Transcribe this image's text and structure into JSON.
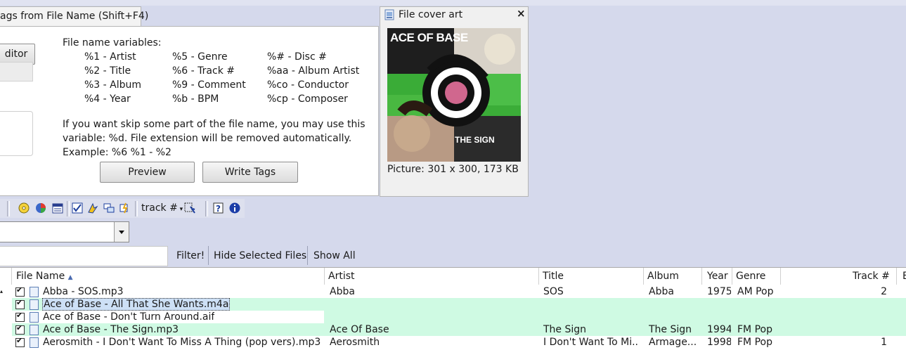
{
  "tag_panel": {
    "tab_title": "ags from File Name (Shift+F4)",
    "editor_button": "ditor",
    "heading": "File name variables:",
    "vars_col1": [
      "%1 - Artist",
      "%2 - Title",
      "%3 - Album",
      "%4 - Year"
    ],
    "vars_col2": [
      "%5 - Genre",
      "%6 - Track #",
      "%9 - Comment",
      "%b - BPM"
    ],
    "vars_col3": [
      "%# - Disc #",
      "%aa - Album Artist",
      "%co - Conductor",
      "%cp - Composer"
    ],
    "help_line1": "If you want skip some part of the file name, you may use this",
    "help_line2": "variable: %d. File extension will be removed automatically.",
    "example": "Example: %6 %1 - %2",
    "preview_button": "Preview",
    "write_button": "Write Tags"
  },
  "cover_panel": {
    "title": "File cover art",
    "art_text_top": "ACE OF BASE",
    "art_text_bottom": "THE SIGN",
    "picture_info": "Picture: 301 x 300, 173 KB"
  },
  "toolbar": {
    "sort_dropdown": "track #"
  },
  "filter_bar": {
    "filter_button": "Filter!",
    "hide_button": "Hide Selected Files",
    "show_all_button": "Show All"
  },
  "file_list": {
    "columns": {
      "file_name": "File Name",
      "artist": "Artist",
      "title": "Title",
      "album": "Album",
      "year": "Year",
      "genre": "Genre",
      "track": "Track #",
      "extra": "B"
    },
    "rows": [
      {
        "file": "Abba - SOS.mp3",
        "artist": "Abba",
        "title": "SOS",
        "album": "Abba",
        "year": "1975",
        "genre": "AM Pop",
        "track": "2",
        "highlight": false,
        "selected": false
      },
      {
        "file": "Ace of Base - All That She Wants.m4a",
        "artist": "",
        "title": "",
        "album": "",
        "year": "",
        "genre": "",
        "track": "",
        "highlight": true,
        "selected": true
      },
      {
        "file": "Ace of Base - Don't Turn Around.aif",
        "artist": "",
        "title": "",
        "album": "",
        "year": "",
        "genre": "",
        "track": "",
        "highlight": false,
        "selected": false
      },
      {
        "file": "Ace of Base - The Sign.mp3",
        "artist": "Ace Of Base",
        "title": "The Sign",
        "album": "The Sign",
        "year": "1994",
        "genre": "FM Pop",
        "track": "",
        "highlight": true,
        "selected": false
      },
      {
        "file": "Aerosmith - I Don't Want To Miss A Thing (pop vers).mp3",
        "artist": "Aerosmith",
        "title": "I Don't Want To Mi...",
        "album": "Armage...",
        "year": "1998",
        "genre": "FM Pop",
        "track": "1",
        "highlight": false,
        "selected": false
      }
    ]
  },
  "colors": {
    "background": "#d5d9ec",
    "row_highlight": "#cffae3"
  }
}
